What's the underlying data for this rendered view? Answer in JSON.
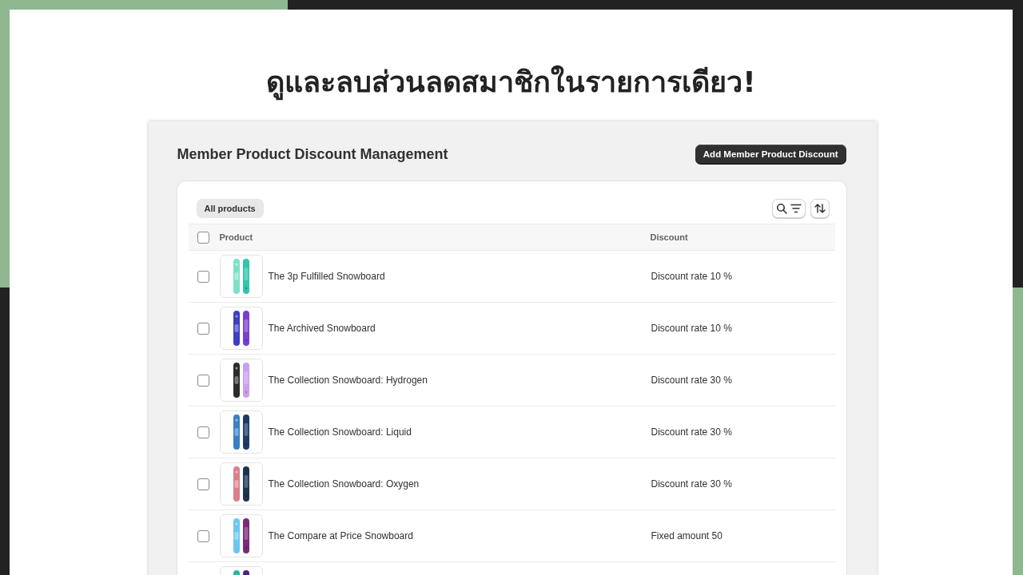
{
  "headline": "ดูและลบส่วนลดสมาชิกในรายการเดียว!",
  "page": {
    "title": "Member Product Discount Management",
    "primary_button": "Add Member Product Discount"
  },
  "tabs": [
    {
      "label": "All products",
      "selected": true
    }
  ],
  "table": {
    "select_all_checked": false,
    "columns": [
      "Product",
      "Discount"
    ],
    "rows": [
      {
        "thumbnail": {
          "kind": "picture"
        },
        "name": "The 3p Fulfilled Snowboard",
        "discount": "Discount rate 10 %",
        "checked": false
      },
      {
        "thumbnail": {
          "kind": "picture"
        },
        "name": "The Archived Snowboard",
        "discount": "Discount rate 10 %",
        "checked": false
      },
      {
        "thumbnail": {
          "kind": "picture"
        },
        "name": "The Collection Snowboard: Hydrogen",
        "discount": "Discount rate 30 %",
        "checked": false
      },
      {
        "thumbnail": {
          "kind": "picture"
        },
        "name": "The Collection Snowboard: Liquid",
        "discount": "Discount rate 30 %",
        "checked": false
      },
      {
        "thumbnail": {
          "kind": "picture"
        },
        "name": "The Collection Snowboard: Oxygen",
        "discount": "Discount rate 30 %",
        "checked": false
      },
      {
        "thumbnail": {
          "kind": "picture"
        },
        "name": "The Compare at Price Snowboard",
        "discount": "Fixed amount 50",
        "checked": false
      },
      {
        "thumbnail": {
          "kind": "picture"
        }
      }
    ]
  }
}
